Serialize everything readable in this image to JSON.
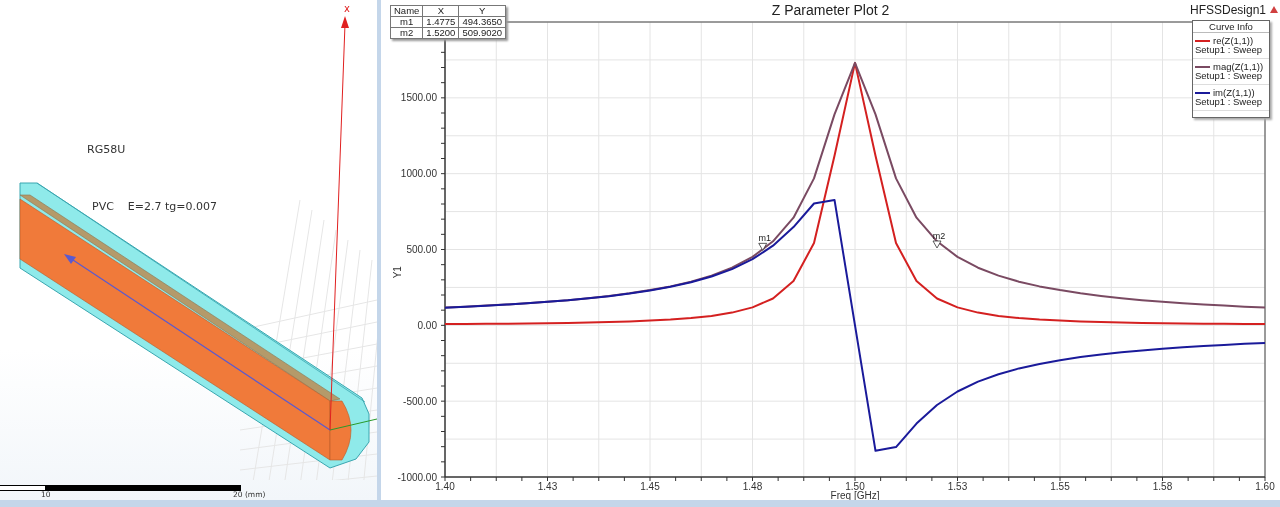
{
  "viewport": {
    "model_label": "RG58U",
    "material_label": "PVC    E=2.7 tg=0.007",
    "axis_label": "x",
    "scale_labels": [
      "10",
      "20 (mm)"
    ]
  },
  "plot": {
    "title": "Z Parameter Plot 2",
    "design": "HFSSDesign1",
    "marker_table": {
      "columns": [
        "Name",
        "X",
        "Y"
      ],
      "rows": [
        [
          "m1",
          "1.4775",
          "494.3650"
        ],
        [
          "m2",
          "1.5200",
          "509.9020"
        ]
      ]
    },
    "legend": {
      "title": "Curve Info",
      "items": [
        {
          "setup": "Setup1 : Sweep"
        },
        {
          "setup": "Setup1 : Sweep"
        },
        {
          "setup": "Setup1 : Sweep"
        }
      ]
    },
    "chart_data": {
      "type": "line",
      "xlabel": "Freq [GHz]",
      "ylabel": "Y1",
      "xlim": [
        1.4,
        1.6
      ],
      "ylim": [
        -1000,
        2000
      ],
      "xticks": [
        {
          "value": 1.4,
          "label": "1.40"
        },
        {
          "value": 1.425,
          "label": "1.43"
        },
        {
          "value": 1.45,
          "label": "1.45"
        },
        {
          "value": 1.475,
          "label": "1.48"
        },
        {
          "value": 1.5,
          "label": "1.50"
        },
        {
          "value": 1.525,
          "label": "1.53"
        },
        {
          "value": 1.55,
          "label": "1.55"
        },
        {
          "value": 1.575,
          "label": "1.58"
        },
        {
          "value": 1.6,
          "label": "1.60"
        }
      ],
      "yticks": [
        {
          "value": -1000,
          "label": "-1000.00"
        },
        {
          "value": -500,
          "label": "-500.00"
        },
        {
          "value": 0,
          "label": "0.00"
        },
        {
          "value": 500,
          "label": "500.00"
        },
        {
          "value": 1000,
          "label": "1000.00"
        },
        {
          "value": 1500,
          "label": "1500.00"
        }
      ],
      "x": [
        1.4,
        1.405,
        1.41,
        1.415,
        1.42,
        1.425,
        1.43,
        1.435,
        1.44,
        1.445,
        1.45,
        1.455,
        1.46,
        1.465,
        1.47,
        1.475,
        1.48,
        1.485,
        1.49,
        1.495,
        1.5,
        1.505,
        1.51,
        1.515,
        1.52,
        1.525,
        1.53,
        1.535,
        1.54,
        1.545,
        1.55,
        1.555,
        1.56,
        1.565,
        1.57,
        1.575,
        1.58,
        1.585,
        1.59,
        1.595,
        1.6
      ],
      "series": [
        {
          "name": "re(Z(1,1))",
          "color": "#d42020",
          "values": [
            8,
            9,
            10,
            11,
            12,
            14,
            16,
            19,
            22,
            26,
            31,
            38,
            48,
            62,
            84,
            118,
            177,
            292,
            542,
            1118,
            1730,
            1118,
            542,
            292,
            177,
            118,
            84,
            62,
            48,
            38,
            31,
            26,
            22,
            19,
            16,
            14,
            12,
            11,
            10,
            9,
            8
          ]
        },
        {
          "name": "mag(Z(1,1))",
          "color": "#7a4a62",
          "values": [
            117,
            123,
            130,
            137,
            146,
            155,
            166,
            179,
            194,
            211,
            232,
            257,
            288,
            328,
            380,
            451,
            554,
            710,
            969,
            1391,
            1730,
            1391,
            969,
            710,
            554,
            451,
            380,
            328,
            288,
            257,
            232,
            211,
            194,
            179,
            166,
            155,
            146,
            137,
            130,
            123,
            117
          ]
        },
        {
          "name": "im(Z(1,1))",
          "color": "#1a1a9a",
          "values": [
            116,
            122,
            129,
            137,
            145,
            155,
            165,
            178,
            192,
            209,
            230,
            254,
            284,
            322,
            371,
            436,
            525,
            648,
            803,
            827,
            0,
            -827,
            -803,
            -648,
            -525,
            -436,
            -371,
            -322,
            -284,
            -254,
            -230,
            -209,
            -192,
            -178,
            -165,
            -155,
            -145,
            -137,
            -129,
            -122,
            -116
          ]
        }
      ],
      "grid": true,
      "annotations": [
        {
          "text": "m1",
          "x": 1.4775,
          "y": 494.365
        },
        {
          "text": "m2",
          "x": 1.52,
          "y": 509.902
        }
      ]
    }
  }
}
